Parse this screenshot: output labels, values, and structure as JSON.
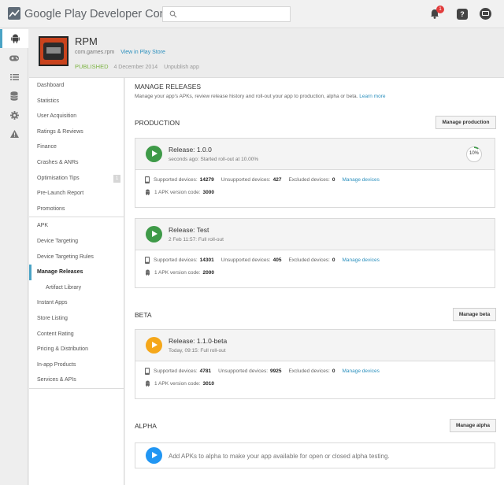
{
  "topbar": {
    "brand": "Google Play Developer Console",
    "notifications_count": "1",
    "help_label": "?"
  },
  "app": {
    "title": "RPM",
    "package": "com.games.rpm",
    "view_link": "View in Play Store",
    "status": "PUBLISHED",
    "date": "4 December 2014",
    "unpublish": "Unpublish app"
  },
  "sidenav": {
    "group1": [
      {
        "label": "Dashboard"
      },
      {
        "label": "Statistics"
      },
      {
        "label": "User Acquisition"
      },
      {
        "label": "Ratings & Reviews"
      },
      {
        "label": "Finance"
      },
      {
        "label": "Crashes & ANRs"
      },
      {
        "label": "Optimisation Tips",
        "badge": "1"
      },
      {
        "label": "Pre-Launch Report"
      },
      {
        "label": "Promotions"
      }
    ],
    "group2": [
      {
        "label": "APK"
      },
      {
        "label": "Device Targeting"
      },
      {
        "label": "Device Targeting Rules"
      },
      {
        "label": "Manage Releases"
      },
      {
        "label": "Artifact Library"
      },
      {
        "label": "Instant Apps"
      },
      {
        "label": "Store Listing"
      },
      {
        "label": "Content Rating"
      },
      {
        "label": "Pricing & Distribution"
      },
      {
        "label": "In-app Products"
      },
      {
        "label": "Services & APIs"
      }
    ]
  },
  "main": {
    "title": "MANAGE RELEASES",
    "subtitle": "Manage your app's APKs, review release history and roll-out your app to production, alpha or beta.",
    "learn_more": "Learn more",
    "production": {
      "title": "PRODUCTION",
      "button": "Manage production",
      "releases": [
        {
          "name": "Release: 1.0.0",
          "meta": "seconds ago: Started roll-out at 10.00%",
          "progress": "10%",
          "supported_label": "Supported devices:",
          "supported": "14279",
          "unsupported_label": "Unsupported devices:",
          "unsupported": "427",
          "excluded_label": "Excluded devices:",
          "excluded": "0",
          "manage": "Manage devices",
          "apk_label": "1 APK version code:",
          "apk": "3000"
        },
        {
          "name": "Release: Test",
          "meta": "2 Feb 11:57: Full roll-out",
          "supported_label": "Supported devices:",
          "supported": "14301",
          "unsupported_label": "Unsupported devices:",
          "unsupported": "405",
          "excluded_label": "Excluded devices:",
          "excluded": "0",
          "manage": "Manage devices",
          "apk_label": "1 APK version code:",
          "apk": "2000"
        }
      ]
    },
    "beta": {
      "title": "BETA",
      "button": "Manage beta",
      "releases": [
        {
          "name": "Release: 1.1.0-beta",
          "meta": "Today, 09:15: Full roll-out",
          "supported_label": "Supported devices:",
          "supported": "4781",
          "unsupported_label": "Unsupported devices:",
          "unsupported": "9925",
          "excluded_label": "Excluded devices:",
          "excluded": "0",
          "manage": "Manage devices",
          "apk_label": "1 APK version code:",
          "apk": "3010"
        }
      ]
    },
    "alpha": {
      "title": "ALPHA",
      "button": "Manage alpha",
      "message": "Add APKs to alpha to make your app available for open or closed alpha testing."
    }
  },
  "colors": {
    "accent": "#4aa3c5",
    "link": "#2a8fbd",
    "published": "#7cb342",
    "release_green": "#3e9a48",
    "release_orange": "#f5a71a",
    "release_blue": "#2196f3"
  },
  "icons": [
    "play-console-logo-icon",
    "search-icon",
    "bell-icon",
    "help-icon",
    "account-icon",
    "android-icon",
    "gamepad-icon",
    "list-icon",
    "database-icon",
    "gear-icon",
    "warning-icon",
    "phone-icon",
    "play-icon"
  ]
}
